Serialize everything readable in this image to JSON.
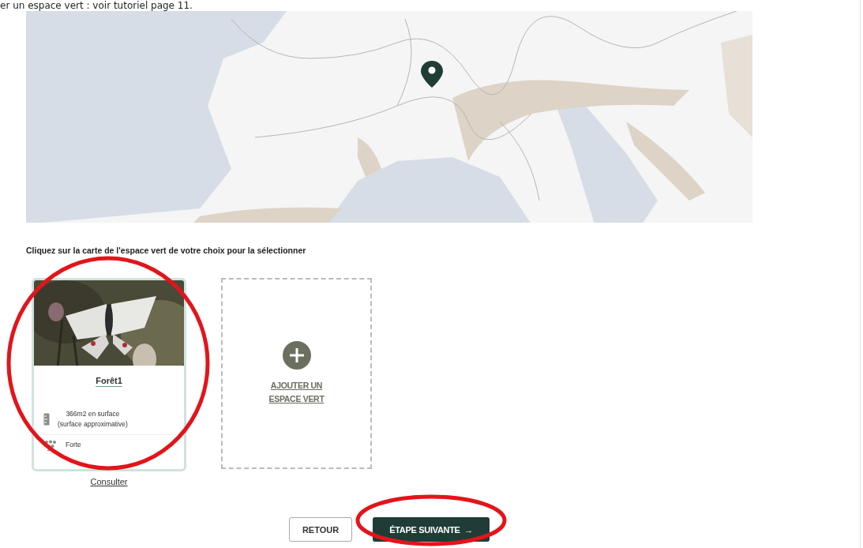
{
  "heading": "er un espace vert : voir tutoriel page 11.",
  "map": {
    "kind": "picture",
    "marker": true
  },
  "instruction": "Cliquez sur la carte de l'espace vert de votre choix pour la sélectionner",
  "spaces": [
    {
      "kind": "space",
      "selected": true,
      "photo": {
        "kind": "picture"
      },
      "title": "Forêt1",
      "details": [
        {
          "kind": "area",
          "text": "366m2 en surface\n(surface approximative)"
        },
        {
          "kind": "visitors",
          "text": "Forte"
        }
      ],
      "link": "Consulter"
    },
    {
      "kind": "add",
      "label": "AJOUTER UN\nESPACE VERT"
    }
  ],
  "buttons": [
    {
      "kind": "secondary",
      "label": "RETOUR"
    },
    {
      "kind": "primary",
      "label": "ÉTAPE SUIVANTE",
      "arrow": "→"
    }
  ],
  "annotations": [
    {
      "kind": "ellipse",
      "color": "#e3141b"
    },
    {
      "kind": "ellipse",
      "color": "#e3141b"
    }
  ]
}
